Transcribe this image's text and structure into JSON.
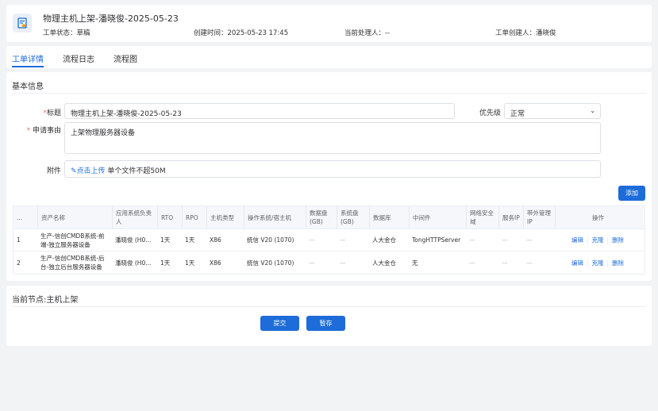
{
  "header": {
    "title": "物理主机上架-潘晓俊-2025-05-23",
    "status": "工单状态：草稿",
    "created": "创建时间：2025-05-23 17:45",
    "handler": "当前处理人：--",
    "creator": "工单创建人：潘晓俊"
  },
  "tabs": [
    "工单详情",
    "流程日志",
    "流程图"
  ],
  "basic": {
    "section_title": "基本信息",
    "title_label": "标题",
    "title_value": "物理主机上架-潘晓俊-2025-05-23",
    "priority_label": "优先级",
    "priority_value": "正常",
    "reason_label": "申请事由",
    "reason_value": "上架物理服务器设备",
    "attach_label": "附件",
    "attach_link": "✎点击上传",
    "attach_hint": "单个文件不超50M",
    "add_button": "添加"
  },
  "table": {
    "columns": [
      "...",
      "资产名称",
      "应用系统负责人",
      "RTO",
      "RPO",
      "主机类型",
      "操作系统/宿主机",
      "数据盘(GB)",
      "系统盘(GB)",
      "数据库",
      "中间件",
      "网络安全域",
      "服务IP",
      "带外管理IP",
      "操作"
    ],
    "rows": [
      {
        "idx": "1",
        "name": "生产-信创CMDB系统-前端-独立服务器设备",
        "owner": "潘晓俊 (H0...",
        "rto": "1天",
        "rpo": "1天",
        "host_type": "X86",
        "os": "统信 V20 (1070)",
        "data_disk": "—",
        "sys_disk": "—",
        "db": "人大金仓",
        "mw": "TongHTTPServer",
        "zone": "—",
        "ip": "—",
        "bmc_ip": "—",
        "ops": [
          "编辑",
          "克隆",
          "删除"
        ]
      },
      {
        "idx": "2",
        "name": "生产-信创CMDB系统-后台-独立后台服务器设备",
        "owner": "潘晓俊 (H0...",
        "rto": "1天",
        "rpo": "1天",
        "host_type": "X86",
        "os": "统信 V20 (1070)",
        "data_disk": "—",
        "sys_disk": "—",
        "db": "人大金仓",
        "mw": "无",
        "zone": "—",
        "ip": "—",
        "bmc_ip": "—",
        "ops": [
          "编辑",
          "克隆",
          "删除"
        ]
      }
    ]
  },
  "footer": {
    "node_title": "当前节点:主机上架",
    "submit": "提交",
    "save": "暂存"
  },
  "colors": {
    "primary": "#1d6cd9",
    "required": "#f56c6c",
    "background": "#f2f3f5"
  }
}
